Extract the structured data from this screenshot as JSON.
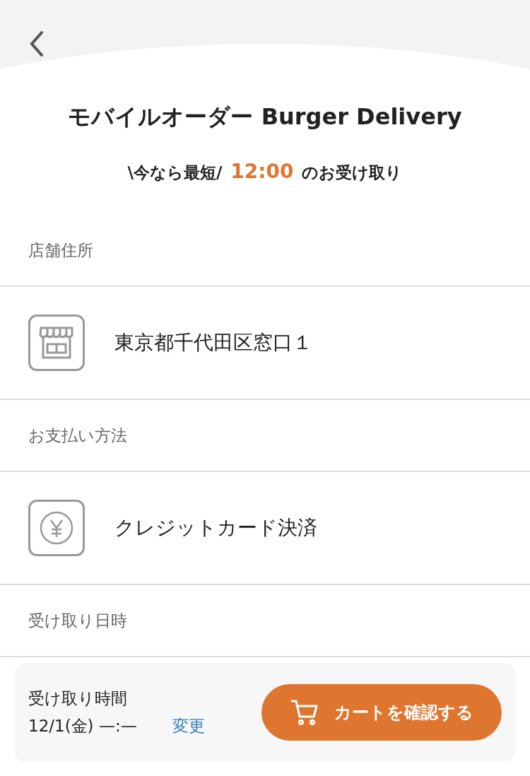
{
  "header": {
    "title": "モバイルオーダー Burger Delivery",
    "subtitle_before": "\\今なら最短/",
    "subtitle_time": "12:00",
    "subtitle_after": "のお受け取り"
  },
  "sections": [
    {
      "label": "店舗住所",
      "kind": "store",
      "value": "東京都千代田区窓口１"
    },
    {
      "label": "お支払い方法",
      "kind": "payment",
      "value": "クレジットカード決済"
    }
  ],
  "pickup": {
    "label": "受け取り日時"
  },
  "bottom_bar": {
    "label": "受け取り時間",
    "value": "12/1(金) —:—",
    "change_link": "変更",
    "cart_button": "カートを確認する"
  }
}
